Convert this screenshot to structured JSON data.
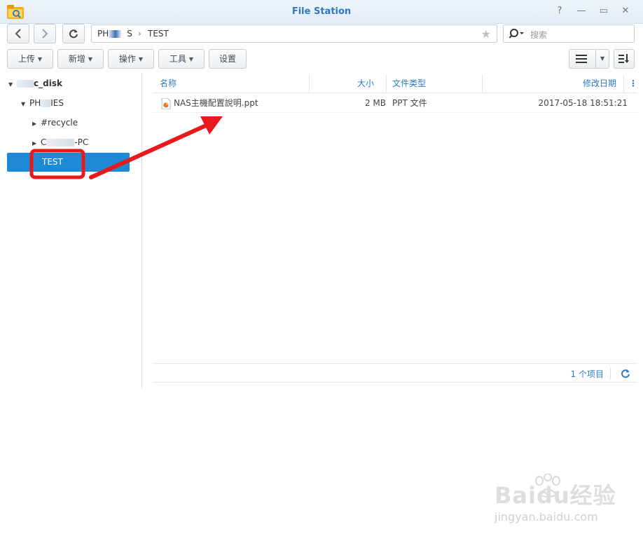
{
  "window": {
    "title": "File Station",
    "controls": [
      "?",
      "—",
      "▭",
      "✕"
    ]
  },
  "nav": {
    "address_prefix": "PH",
    "address_suffix": "S",
    "address_current": "TEST",
    "search_placeholder": "搜索"
  },
  "toolbar": {
    "upload": "上传",
    "create": "新增",
    "action": "操作",
    "tools": "工具",
    "settings": "设置"
  },
  "tree": {
    "root_suffix": "c_disk",
    "share_prefix": "PH",
    "share_suffix": "IES",
    "recycle": "#recycle",
    "pc_prefix": "C",
    "pc_suffix": "-PC",
    "selected": "TEST"
  },
  "columns": {
    "name": "名称",
    "size": "大小",
    "type": "文件类型",
    "modified": "修改日期"
  },
  "files": [
    {
      "name": "NAS主機配置說明.ppt",
      "size": "2 MB",
      "type": "PPT 文件",
      "modified": "2017-05-18 18:51:21"
    }
  ],
  "footer": {
    "count": "1 个项目"
  },
  "watermark": {
    "brand": "Baidu经验",
    "url": "jingyan.baidu.com"
  },
  "colors": {
    "accent": "#2a7ac6",
    "selection": "#1e8ad6",
    "annotation": "#e8191c"
  }
}
